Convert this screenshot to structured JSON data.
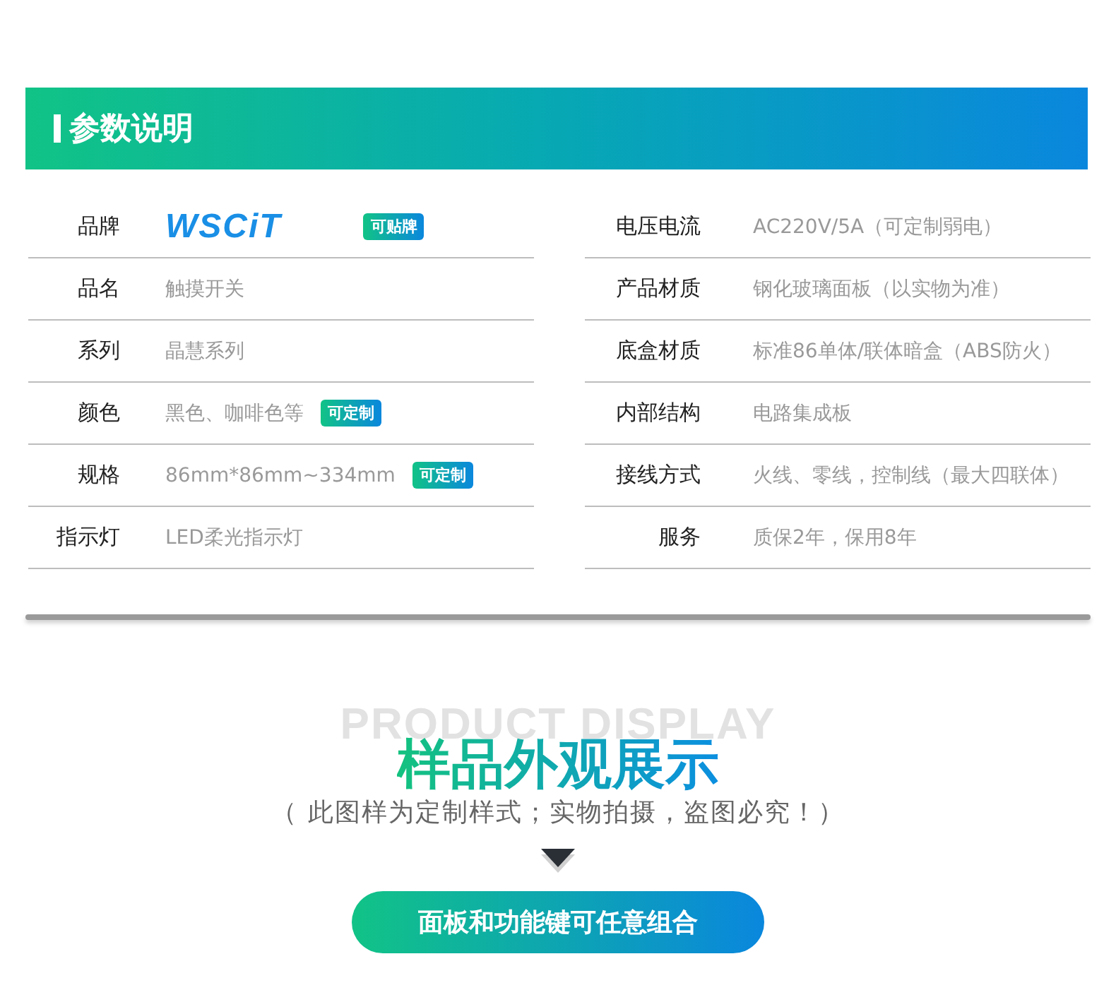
{
  "header": {
    "title": "参数说明"
  },
  "params_left": [
    {
      "label": "品牌",
      "kind": "logo",
      "value": "WSCiT",
      "badge": "可贴牌"
    },
    {
      "label": "品名",
      "kind": "text",
      "value": "触摸开关"
    },
    {
      "label": "系列",
      "kind": "text",
      "value": "晶慧系列"
    },
    {
      "label": "颜色",
      "kind": "text",
      "value": "黑色、咖啡色等",
      "badge": "可定制"
    },
    {
      "label": "规格",
      "kind": "text",
      "value": "86mm*86mm~334mm",
      "badge": "可定制"
    },
    {
      "label": "指示灯",
      "kind": "text",
      "value": "LED柔光指示灯"
    }
  ],
  "params_right": [
    {
      "label": "电压电流",
      "kind": "text",
      "value": "AC220V/5A（可定制弱电）"
    },
    {
      "label": "产品材质",
      "kind": "text",
      "value": "钢化玻璃面板（以实物为准）"
    },
    {
      "label": "底盒材质",
      "kind": "text",
      "value": "标准86单体/联体暗盒（ABS防火）"
    },
    {
      "label": "内部结构",
      "kind": "text",
      "value": "电路集成板"
    },
    {
      "label": "接线方式",
      "kind": "text",
      "value": "火线、零线，控制线（最大四联体）"
    },
    {
      "label": "服务",
      "kind": "text",
      "value": "质保2年，保用8年"
    }
  ],
  "display": {
    "background_title": "PRODUCT DISPLAY",
    "title": "样品外观展示",
    "subtitle": "（ 此图样为定制样式；实物拍摄，盗图必究！）",
    "button": "面板和功能键可任意组合"
  }
}
